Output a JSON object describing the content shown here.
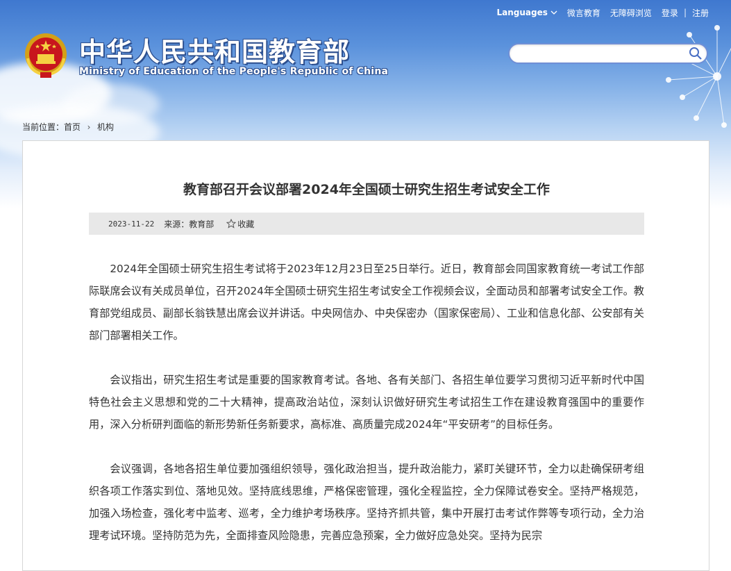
{
  "header": {
    "languages_label": "Languages",
    "links": [
      "微言教育",
      "无障碍浏览",
      "登录",
      "注册"
    ],
    "site_title_cn": "中华人民共和国教育部",
    "site_title_en": "Ministry of Education of the People's Republic of China",
    "search_placeholder": ""
  },
  "breadcrumb": {
    "prefix": "当前位置：",
    "items": [
      "首页",
      "机构"
    ]
  },
  "article": {
    "title": "教育部召开会议部署2024年全国硕士研究生招生考试安全工作",
    "date": "2023-11-22",
    "source": "来源：教育部",
    "favorite_label": "收藏",
    "paragraphs": [
      "2024年全国硕士研究生招生考试将于2023年12月23日至25日举行。近日，教育部会同国家教育统一考试工作部际联席会议有关成员单位，召开2024年全国硕士研究生招生考试安全工作视频会议，全面动员和部署考试安全工作。教育部党组成员、副部长翁铁慧出席会议并讲话。中央网信办、中央保密办（国家保密局）、工业和信息化部、公安部有关部门部署相关工作。",
      "会议指出，研究生招生考试是重要的国家教育考试。各地、各有关部门、各招生单位要学习贯彻习近平新时代中国特色社会主义思想和党的二十大精神，提高政治站位，深刻认识做好研究生考试招生工作在建设教育强国中的重要作用，深入分析研判面临的新形势新任务新要求，高标准、高质量完成2024年“平安研考”的目标任务。",
      "会议强调，各地各招生单位要加强组织领导，强化政治担当，提升政治能力，紧盯关键环节，全力以赴确保研考组织各项工作落实到位、落地见效。坚持底线思维，严格保密管理，强化全程监控，全力保障试卷安全。坚持严格规范，加强入场检查，强化考中监考、巡考，全力维护考场秩序。坚持齐抓共管，集中开展打击考试作弊等专项行动，全力治理考试环境。坚持防范为先，全面排查风险隐患，完善应急预案，全力做好应急处突。坚持为民宗"
    ]
  },
  "colors": {
    "sky_top": "#3f78cf",
    "search_border": "#6f8fd6",
    "meta_bg": "#e8e8e8",
    "text": "#333333"
  }
}
